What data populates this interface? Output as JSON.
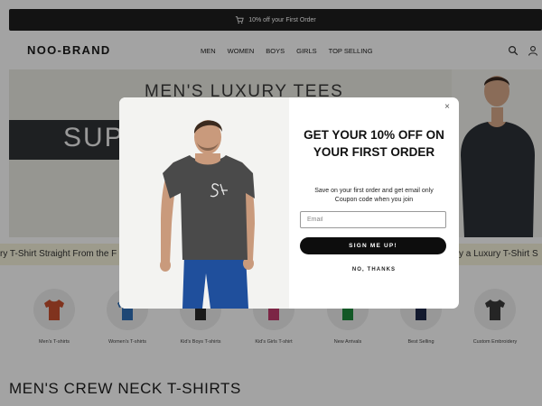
{
  "promo": {
    "text": "10% off your First Order",
    "icon": "cart-icon"
  },
  "header": {
    "logo": "NOO-BRAND",
    "nav": [
      "MEN",
      "WOMEN",
      "BOYS",
      "GIRLS",
      "TOP SELLING"
    ],
    "icons": [
      "search-icon",
      "user-icon"
    ]
  },
  "hero": {
    "title": "MEN'S LUXURY TEES",
    "band_text": "SUP"
  },
  "marquee": {
    "left_text": "ry T-Shirt Straight From the F",
    "right_text": "y a Luxury T-Shirt S"
  },
  "categories": [
    {
      "label": "Men's T-shirts",
      "color": "#c8512f"
    },
    {
      "label": "Women's T-shirts",
      "color": "#2f6fb8"
    },
    {
      "label": "Kid's Boys T-shirts",
      "color": "#2a2a2a"
    },
    {
      "label": "Kid's Girls T-shirt",
      "color": "#c23b6d"
    },
    {
      "label": "New Arrivals",
      "color": "#1e8a3c"
    },
    {
      "label": "Best Selling",
      "color": "#1f2a4a"
    },
    {
      "label": "Custom Embroidery",
      "color": "#3a3a3a"
    }
  ],
  "section_title": "MEN'S CREW NECK T-SHIRTS",
  "modal": {
    "headline": "GET YOUR 10% OFF ON YOUR FIRST ORDER",
    "sub_line1": "Save on your first order and get email only",
    "sub_line2": "Coupon code when you join",
    "email_placeholder": "Email",
    "email_value": "",
    "signup_label": "SIGN ME UP!",
    "no_thanks_label": "NO, THANKS",
    "close_glyph": "×"
  },
  "colors": {
    "promo_bg": "#1f1f1f",
    "button_bg": "#0d0d0d",
    "marquee_bg": "#f6f3dc",
    "hero_bg": "#ebebe3",
    "shirt_charcoal": "#4a4a4a",
    "jeans_blue": "#1f4f9c"
  }
}
